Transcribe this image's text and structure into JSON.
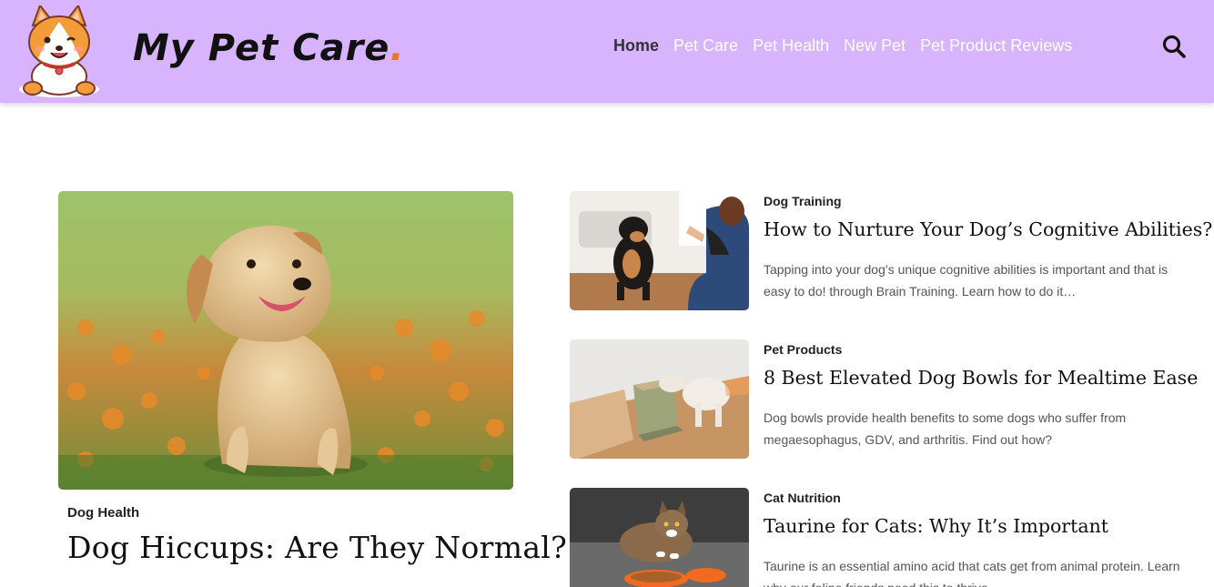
{
  "header": {
    "brand_name": "My Pet Care",
    "brand_dot": ".",
    "brand_color": "#111111",
    "accent_dot_color": "#f0761b",
    "background_color": "#d8b4fe",
    "logo_icon": "corgi-mascot-icon"
  },
  "nav": {
    "items": [
      {
        "label": "Home",
        "active": true
      },
      {
        "label": "Pet Care",
        "active": false
      },
      {
        "label": "Pet Health",
        "active": false
      },
      {
        "label": "New Pet",
        "active": false
      },
      {
        "label": "Pet Product Reviews",
        "active": false
      }
    ],
    "search_icon": "search-icon"
  },
  "featured": {
    "category": "Dog Health",
    "title": "Dog Hiccups: Are They Normal?",
    "image": "golden-retriever-puppy-in-flower-field"
  },
  "posts": [
    {
      "category": "Dog Training",
      "title": "How to Nurture Your Dog’s Cognitive Abilities?",
      "excerpt": "Tapping into your dog’s unique cognitive abilities is important and that is easy to do! through Brain Training. Learn how to do it…",
      "image": "dog-high-five-with-owner"
    },
    {
      "category": "Pet Products",
      "title": "8 Best Elevated Dog Bowls for Mealtime Ease",
      "excerpt": "Dog bowls provide health benefits to some dogs who suffer from megaesophagus, GDV, and arthritis. Find out how?",
      "image": "dog-eating-from-elevated-bowl"
    },
    {
      "category": "Cat Nutrition",
      "title": "Taurine for Cats: Why It’s Important",
      "excerpt": "Taurine is an essential amino acid that cats get from animal protein. Learn why our feline friends need this to thrive.",
      "image": "tabby-cat-with-food-bowl"
    }
  ]
}
